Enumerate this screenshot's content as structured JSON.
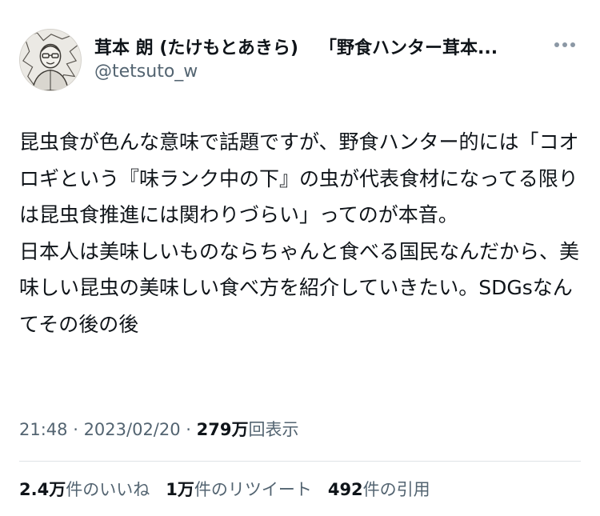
{
  "author": {
    "display_name": "茸本 朗 (たけもとあきら)",
    "name_suffix": "「野食ハンター茸本...",
    "handle": "@tetsuto_w"
  },
  "tweet": {
    "paragraphs": [
      "昆虫食が色んな意味で話題ですが、野食ハンター的には「コオロギという『味ランク中の下』の虫が代表食材になってる限りは昆虫食推進には関わりづらい」ってのが本音。",
      "日本人は美味しいものならちゃんと食べる国民なんだから、美味しい昆虫の美味しい食べ方を紹介していきたい。SDGsなんてその後の後"
    ]
  },
  "meta": {
    "time": "21:48",
    "separator": " · ",
    "date": "2023/02/20",
    "views_count": "279万",
    "views_label": "回表示"
  },
  "stats": {
    "likes_count": "2.4万",
    "likes_label": "件のいいね",
    "retweets_count": "1万",
    "retweets_label": "件のリツイート",
    "quotes_count": "492",
    "quotes_label": "件の引用"
  },
  "icons": {
    "more": "more-horizontal-icon",
    "avatar": "avatar-image"
  },
  "colors": {
    "text_primary": "#0f1419",
    "text_secondary": "#536471",
    "divider": "#dfe3e6"
  }
}
